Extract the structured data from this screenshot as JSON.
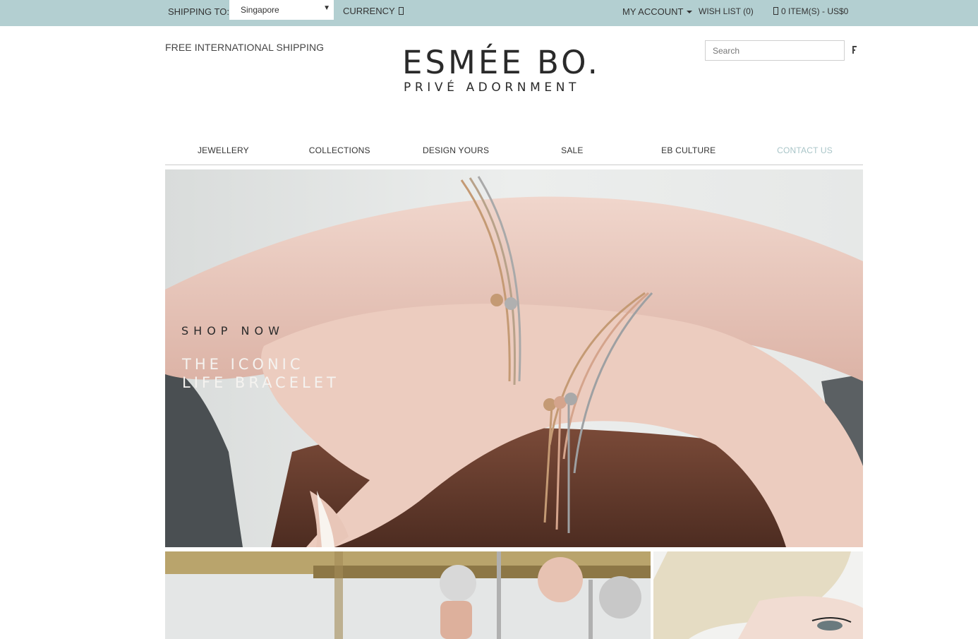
{
  "topbar": {
    "shipping_label": "SHIPPING TO:",
    "shipping_value": "Singapore",
    "currency_label": "CURRENCY",
    "account_label": "MY ACCOUNT",
    "wishlist_label": "WISH LIST (0)",
    "cart_label": "0 ITEM(S) - US$0",
    "bg_color": "#b3cfd1"
  },
  "header": {
    "free_shipping": "FREE INTERNATIONAL SHIPPING",
    "logo_main": "ESMÉE BO.",
    "logo_sub": "PRIVÉ ADORNMENT",
    "search_placeholder": "Search"
  },
  "nav": {
    "items": [
      {
        "label": "JEWELLERY"
      },
      {
        "label": "COLLECTIONS"
      },
      {
        "label": "DESIGN YOURS"
      },
      {
        "label": "SALE"
      },
      {
        "label": "EB CULTURE"
      },
      {
        "label": "CONTACT US"
      }
    ],
    "muted_color": "#a9c5c8"
  },
  "hero": {
    "shop_now": "SHOP NOW",
    "title_line1": "THE ICONIC",
    "title_line2": "LIFE BRACELET"
  }
}
